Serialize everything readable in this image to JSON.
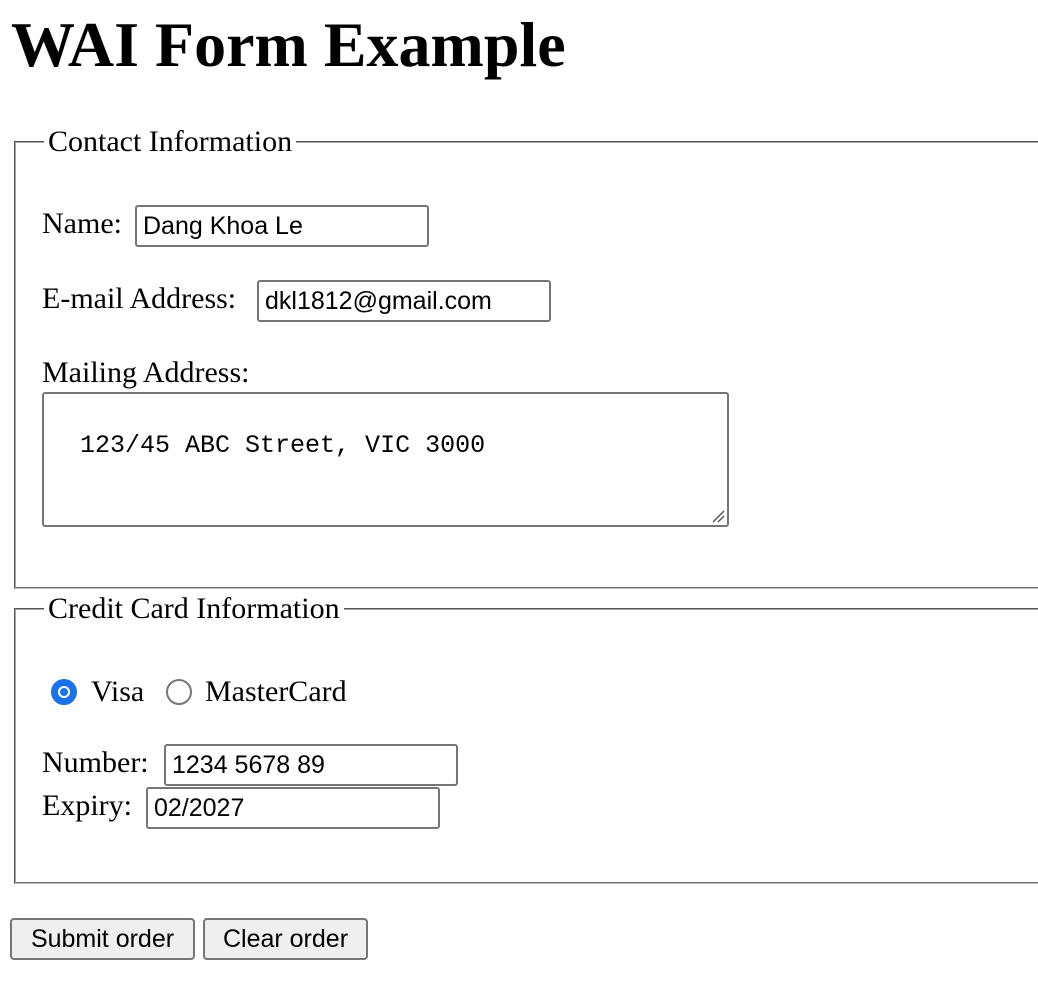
{
  "page": {
    "title": "WAI Form Example"
  },
  "contact": {
    "legend": "Contact Information",
    "name_label": "Name:",
    "name_value": "Dang Khoa Le",
    "email_label": "E-mail Address:",
    "email_value": "dkl1812@gmail.com",
    "address_label": "Mailing Address:",
    "address_value": "123/45 ABC Street, VIC 3000"
  },
  "credit": {
    "legend": "Credit Card Information",
    "card_types": [
      {
        "label": "Visa",
        "checked": true
      },
      {
        "label": "MasterCard",
        "checked": false
      }
    ],
    "number_label": "Number:",
    "number_value": "1234 5678 89",
    "expiry_label": "Expiry:",
    "expiry_value": "02/2027"
  },
  "actions": {
    "submit_label": "Submit order",
    "clear_label": "Clear order"
  },
  "colors": {
    "radio_checked": "#1a73e8",
    "input_border": "#767676",
    "button_bg": "#efefef"
  }
}
